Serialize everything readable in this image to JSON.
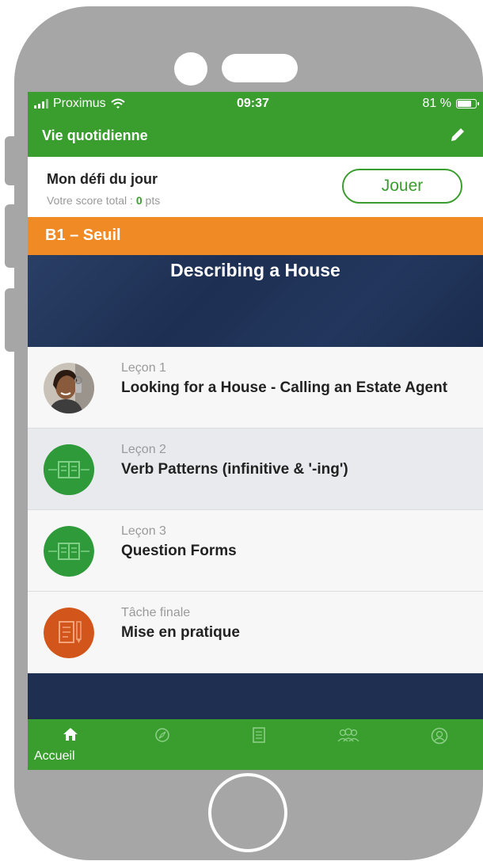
{
  "status_bar": {
    "carrier": "Proximus",
    "time": "09:37",
    "battery": "81 %",
    "battery_level": 0.81
  },
  "app_bar": {
    "title": "Vie quotidienne",
    "edit_icon": "pencil-icon"
  },
  "daily_challenge": {
    "title": "Mon défi du jour",
    "score_prefix": "Votre score total : ",
    "score_value": "0",
    "score_suffix": " pts",
    "play_label": "Jouer"
  },
  "level": {
    "label": "B1 – Seuil"
  },
  "unit": {
    "title": "Describing a House"
  },
  "lessons": [
    {
      "label": "Leçon 1",
      "name": "Looking for a House - Calling an Estate Agent",
      "icon": "photo-woman-keys"
    },
    {
      "label": "Leçon 2",
      "name": "Verb Patterns (infinitive & '-ing')",
      "icon": "book-icon"
    },
    {
      "label": "Leçon 3",
      "name": "Question Forms",
      "icon": "book-icon"
    },
    {
      "label": "Tâche finale",
      "name": "Mise en pratique",
      "icon": "task-icon"
    }
  ],
  "tab_bar": {
    "active_label": "Accueil",
    "tabs": [
      "home-icon",
      "compass-icon",
      "book-icon",
      "users-icon",
      "profile-icon"
    ]
  },
  "colors": {
    "green": "#3a9e2f",
    "orange": "#f08a24",
    "navy": "#1f2f52",
    "phone_frame": "#a6a6a6"
  }
}
